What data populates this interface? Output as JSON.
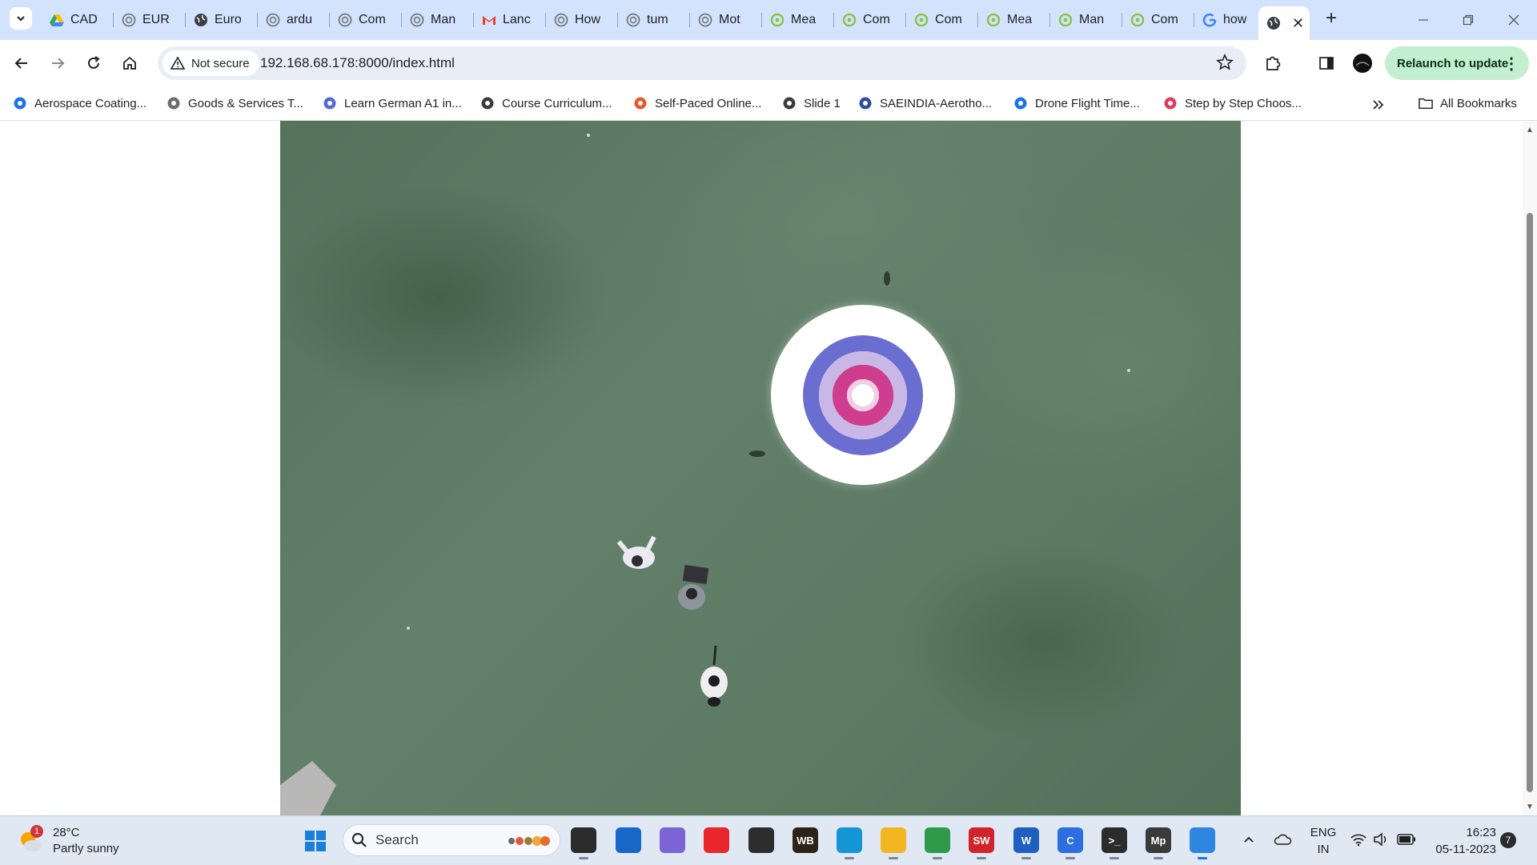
{
  "browser": {
    "tabs": [
      {
        "title": "CAD",
        "icon": "google-drive-icon"
      },
      {
        "title": "EUR",
        "icon": "site-icon"
      },
      {
        "title": "Euro",
        "icon": "globe-icon"
      },
      {
        "title": "ardu",
        "icon": "site-icon"
      },
      {
        "title": "Com",
        "icon": "site-icon"
      },
      {
        "title": "Man",
        "icon": "site-icon"
      },
      {
        "title": "Lanc",
        "icon": "gmail-icon"
      },
      {
        "title": "How",
        "icon": "site-icon"
      },
      {
        "title": "tum",
        "icon": "site-icon"
      },
      {
        "title": "Mot",
        "icon": "site-icon"
      },
      {
        "title": "Mea",
        "icon": "green-circle-icon"
      },
      {
        "title": "Com",
        "icon": "green-circle-icon"
      },
      {
        "title": "Com",
        "icon": "green-circle-icon"
      },
      {
        "title": "Mea",
        "icon": "green-circle-icon"
      },
      {
        "title": "Man",
        "icon": "green-circle-icon"
      },
      {
        "title": "Com",
        "icon": "green-circle-icon"
      },
      {
        "title": "how",
        "icon": "google-icon"
      },
      {
        "title": "",
        "icon": "globe-icon",
        "active": true
      }
    ],
    "security_label": "Not secure",
    "url": "192.168.68.178:8000/index.html",
    "relaunch_label": "Relaunch to update",
    "bookmarks": [
      {
        "label": "Aerospace Coating...",
        "color": "#1a73e8"
      },
      {
        "label": "Goods & Services T...",
        "color": "#6d6d6d"
      },
      {
        "label": "Learn German A1 in...",
        "color": "#4f6bd8"
      },
      {
        "label": "Course Curriculum...",
        "color": "#3c3c3c"
      },
      {
        "label": "Self-Paced Online...",
        "color": "#e8552b"
      },
      {
        "label": "Slide 1",
        "color": "#3c3c3c"
      },
      {
        "label": "SAEINDIA-Aerotho...",
        "color": "#2a4d9b"
      },
      {
        "label": "Drone Flight Time...",
        "color": "#1a73e8"
      },
      {
        "label": "Step by Step Choos...",
        "color": "#e33b5a"
      }
    ],
    "all_bookmarks_label": "All Bookmarks"
  },
  "taskbar": {
    "weather": {
      "temp": "28°C",
      "condition": "Partly sunny",
      "badge": "1"
    },
    "search_label": "Search",
    "apps": [
      {
        "name": "task-view-icon",
        "label": "",
        "color": "#2b2b2b"
      },
      {
        "name": "microsoft-store-icon",
        "label": "",
        "color": "#1767c9"
      },
      {
        "name": "copilot-icon",
        "label": "",
        "color": "#7d63d6"
      },
      {
        "name": "red-diamond-app-icon",
        "label": "",
        "color": "#e8262b"
      },
      {
        "name": "obs-studio-icon",
        "label": "",
        "color": "#2d2d2d"
      },
      {
        "name": "workbench-icon",
        "label": "WB",
        "color": "#2b2317"
      },
      {
        "name": "edge-icon",
        "label": "",
        "color": "#1596d4"
      },
      {
        "name": "file-explorer-icon",
        "label": "",
        "color": "#f2b623"
      },
      {
        "name": "chrome-icon",
        "label": "",
        "color": "#2e9b4a"
      },
      {
        "name": "solidworks-icon",
        "label": "SW",
        "color": "#d2232a"
      },
      {
        "name": "word-icon",
        "label": "W",
        "color": "#1f5fbf"
      },
      {
        "name": "c-app-icon",
        "label": "C",
        "color": "#2d6ee0"
      },
      {
        "name": "terminal-icon",
        "label": ">_",
        "color": "#2c2c2c"
      },
      {
        "name": "mission-planner-icon",
        "label": "Mp",
        "color": "#3a3a3a"
      },
      {
        "name": "snipping-tool-icon",
        "label": "",
        "color": "#2d86e0"
      }
    ],
    "lang": {
      "line1": "ENG",
      "line2": "IN"
    },
    "clock": {
      "time": "16:23",
      "date": "05-11-2023"
    },
    "notification_count": "7"
  }
}
